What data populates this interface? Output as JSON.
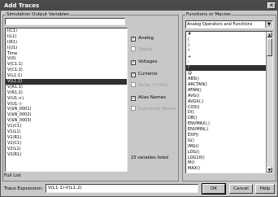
{
  "window": {
    "title": "Add Traces",
    "close_symbol": "×"
  },
  "variables": {
    "group_label": "Simulation Output Variables",
    "filter_value": "",
    "items": [
      "I(C1)",
      "I(L1)",
      "I(R1)",
      "I(U1)",
      "Time",
      "V(0)",
      "V(C1:1)",
      "V(C1:2)",
      "V(L1:1)",
      "V(L1:2)",
      "V(R1:1)",
      "V(R1:2)",
      "V(U1:+)",
      "V(U1:-)",
      "V($N_0001)",
      "V($N_0002)",
      "V($N_0003)",
      "V1(C1)",
      "V1(L1)",
      "V1(R1)",
      "V2(C1)",
      "V2(L1)",
      "V2(R1)"
    ],
    "selected_index": 9,
    "full_list_label": "Full List"
  },
  "options": [
    {
      "label": "Analog",
      "checked": true,
      "enabled": true
    },
    {
      "label": "Digital",
      "checked": false,
      "enabled": false
    },
    {
      "label": "Voltages",
      "checked": true,
      "enabled": true
    },
    {
      "label": "Currents",
      "checked": true,
      "enabled": true
    },
    {
      "label": "Noise (V²/Hz)",
      "checked": false,
      "enabled": false
    },
    {
      "label": "Alias Names",
      "checked": true,
      "enabled": true
    },
    {
      "label": "Subcircuit Nodes",
      "checked": false,
      "enabled": false
    }
  ],
  "check_mark": "✓",
  "count_text": "23 variables listed",
  "functions": {
    "group_label": "Functions or Macros",
    "selected_category": "Analog Operators and Functions",
    "dropdown_arrow": "▼",
    "items": [
      "#",
      "(",
      ")",
      "*",
      "+",
      "-",
      "/",
      "@",
      "ABS()",
      "ARCTAN()",
      "ATAN()",
      "AVG()",
      "AVGX(,)",
      "COS()",
      "D()",
      "DB()",
      "ENVMAX(,)",
      "ENVMIN(,)",
      "EXP()",
      "G()",
      "IMG()",
      "LOG()",
      "LOG10()",
      "M()",
      "MAX()"
    ],
    "selected_index": 6,
    "scroll_up": "▲",
    "scroll_down": "▼"
  },
  "expression": {
    "label": "Trace Expression:",
    "value": "V(L1:1)-V(L1:2)"
  },
  "buttons": {
    "ok": "OK",
    "cancel": "Cancel",
    "help": "Help"
  }
}
